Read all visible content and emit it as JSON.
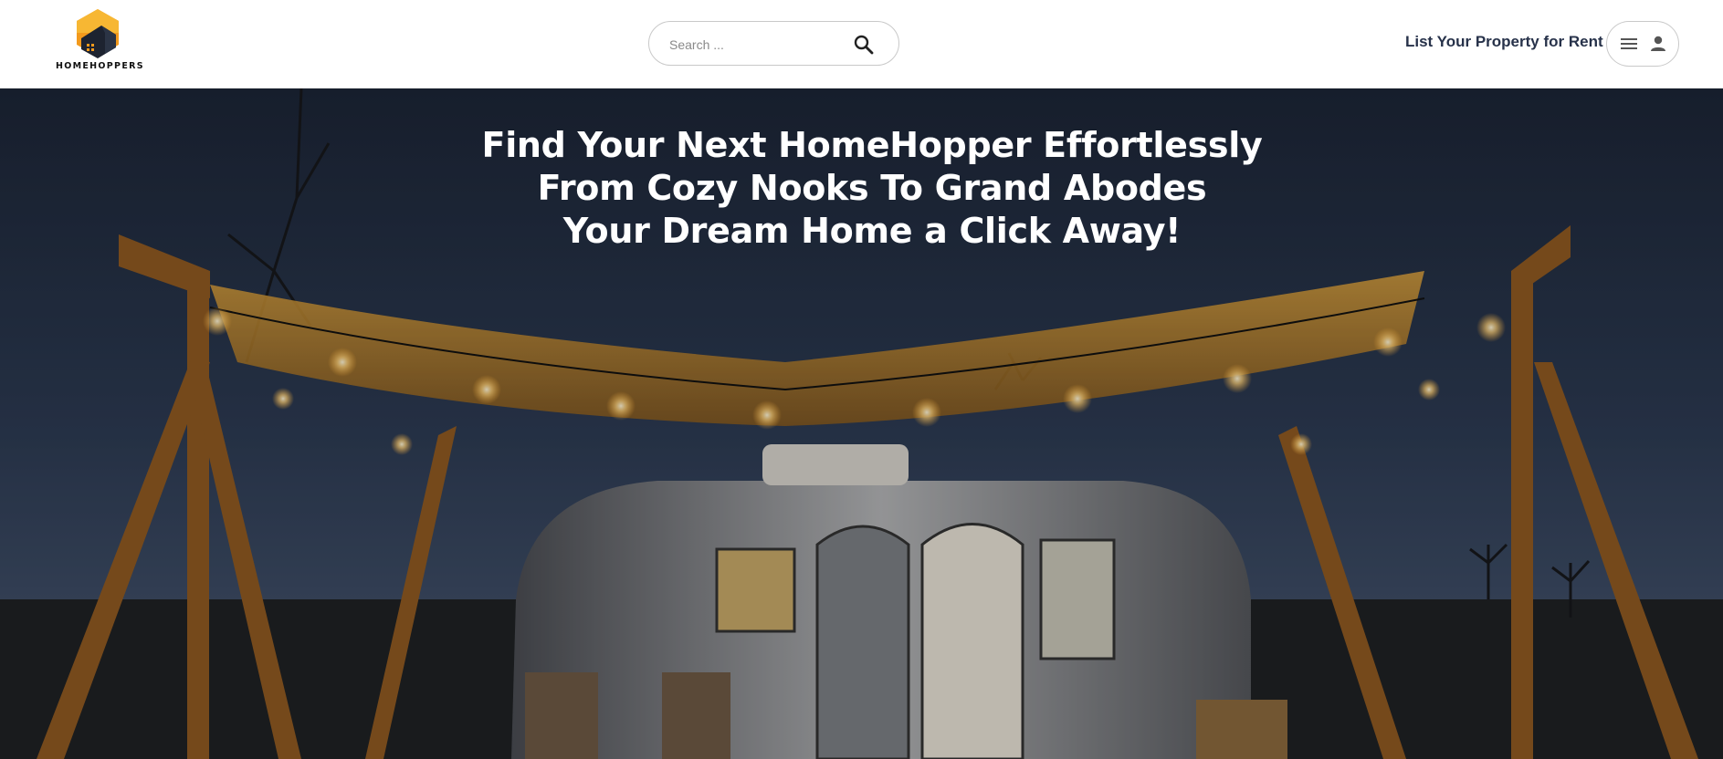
{
  "brand": {
    "name": "HOMEHOPPERS",
    "logo_icon": "house-hexagon-logo-icon"
  },
  "search": {
    "placeholder": "Search ...",
    "icon": "search-icon"
  },
  "nav": {
    "list_property_label": "List Your Property for Rent"
  },
  "user_menu": {
    "icons": [
      "hamburger-menu-icon",
      "user-icon"
    ]
  },
  "hero": {
    "lines": [
      "Find Your Next HomeHopper Effortlessly",
      "From Cozy Nooks To Grand Abodes",
      "Your Dream Home a Click Away!"
    ],
    "background_image": "airstream-trailer-under-string-lights-at-dusk"
  },
  "colors": {
    "logo_orange": "#f39a1c",
    "logo_dark": "#1d2330",
    "nav_text": "#27324a",
    "hero_text": "#ffffff"
  }
}
